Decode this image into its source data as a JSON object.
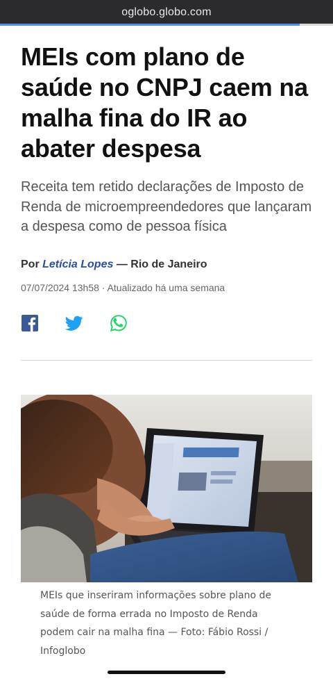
{
  "browser": {
    "url": "oglobo.globo.com",
    "load_progress": 0.9
  },
  "article": {
    "headline": "MEIs com plano de saúde no CNPJ caem na malha fina do IR ao abater despesa",
    "subtitle": "Receita tem retido declarações de Imposto de Renda de microempreendedores que lançaram a despesa como de pessoa física",
    "byline": {
      "prefix": "Por",
      "author": "Letícia Lopes",
      "separator": "—",
      "location": "Rio de Janeiro"
    },
    "date": "07/07/2024 13h58 · Atualizado há uma semana",
    "share": {
      "icons": [
        "facebook-icon",
        "twitter-icon",
        "whatsapp-icon"
      ],
      "colors": {
        "facebook": "#3b5998",
        "twitter": "#1da1f2",
        "whatsapp": "#25d366"
      }
    },
    "photo_caption": "MEIs que inseriram informações sobre plano de saúde de forma errada no Imposto de Renda podem cair na malha fina — Foto: Fábio Rossi / Infoglobo"
  },
  "colors": {
    "headline": "#111111",
    "author_link": "#2a4f9e",
    "url_bar": "#2b2b2d"
  }
}
